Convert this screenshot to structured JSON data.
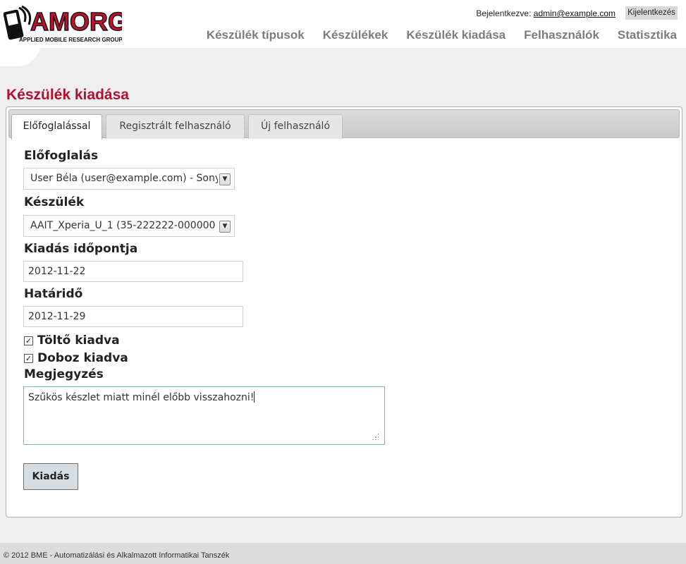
{
  "logo": {
    "main": "AMORG",
    "sub": "APPLIED MOBILE RESEARCH GROUP"
  },
  "header": {
    "login_prefix": "Bejelentkezve:",
    "login_user": "admin@example.com",
    "logout_label": "Kijelentkezés"
  },
  "nav": [
    {
      "label": "Készülék típusok"
    },
    {
      "label": "Készülékek"
    },
    {
      "label": "Készülék kiadása"
    },
    {
      "label": "Felhasználók"
    },
    {
      "label": "Statisztika"
    }
  ],
  "page": {
    "title": "Készülék kiadása"
  },
  "tabs": [
    {
      "label": "Előfoglalással",
      "active": true
    },
    {
      "label": "Regisztrált felhasználó",
      "active": false
    },
    {
      "label": "Új felhasználó",
      "active": false
    }
  ],
  "form": {
    "reservation_label": "Előfoglalás",
    "reservation_value": "User Béla (user@example.com) - Sony",
    "device_label": "Készülék",
    "device_value": "AAIT_Xperia_U_1 (35-222222-000000",
    "issue_date_label": "Kiadás időpontja",
    "issue_date_value": "2012-11-22",
    "deadline_label": "Határidő",
    "deadline_value": "2012-11-29",
    "charger_label": "Töltő kiadva",
    "charger_checked": true,
    "box_label": "Doboz kiadva",
    "box_checked": true,
    "note_label": "Megjegyzés",
    "note_value": "Szűkös készlet miatt minél előbb visszahozni!",
    "submit_label": "Kiadás"
  },
  "footer": {
    "text": "© 2012 BME - Automatizálási és Alkalmazott Informatikai Tanszék"
  },
  "colors": {
    "title": "#b01030",
    "logo_red": "#c8102e",
    "nav": "#7c7c7c"
  }
}
